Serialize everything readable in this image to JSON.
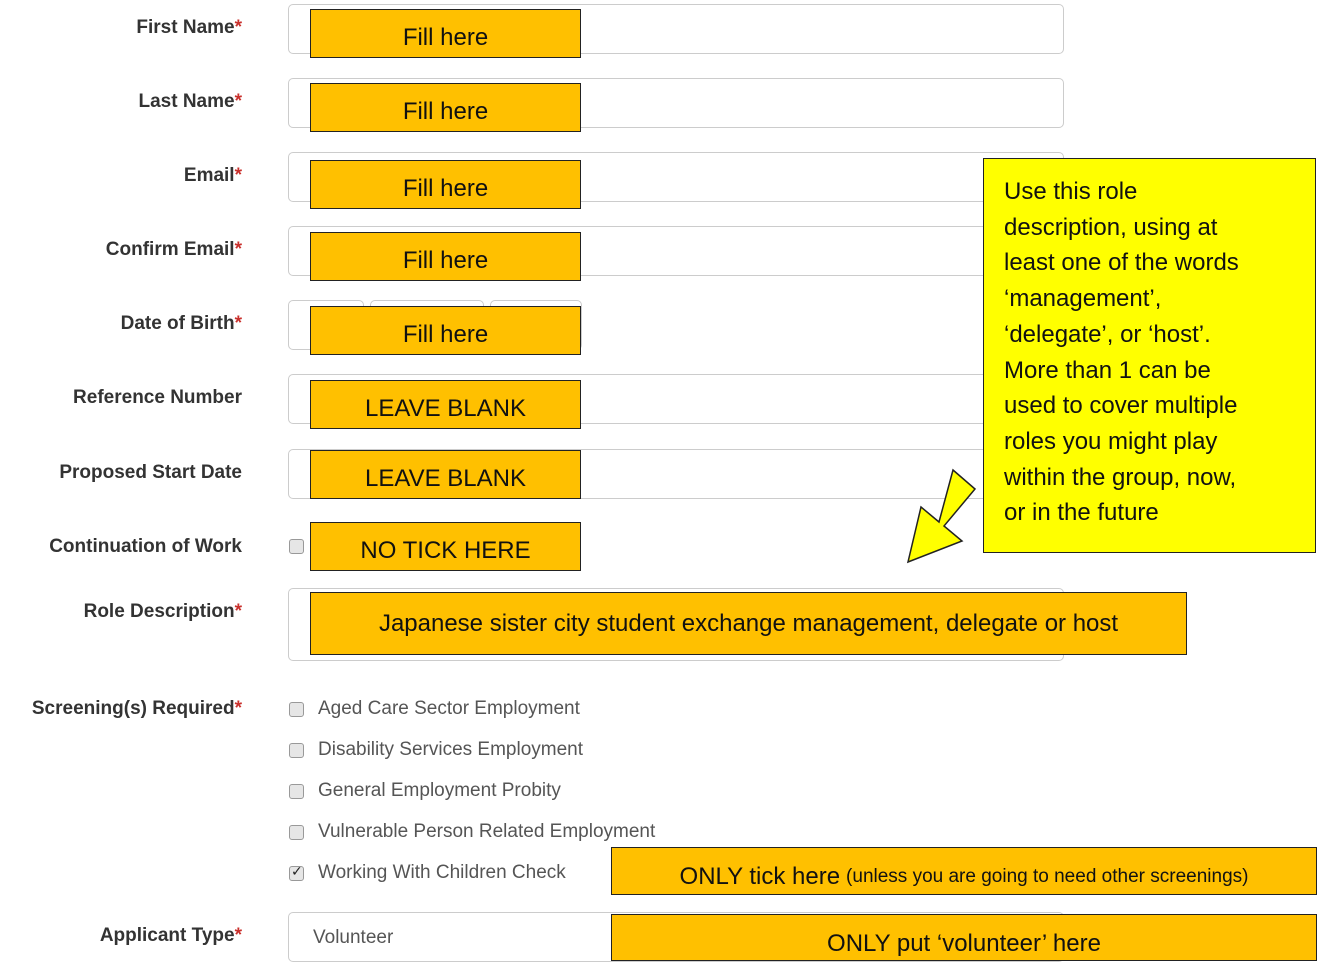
{
  "fields": {
    "first_name": "First Name",
    "last_name": "Last Name",
    "email": "Email",
    "confirm_email": "Confirm Email",
    "dob": "Date of Birth",
    "reference_number": "Reference Number",
    "proposed_start_date": "Proposed Start Date",
    "continuation_of_work": "Continuation of Work",
    "role_description": "Role Description",
    "screenings_required": "Screening(s) Required",
    "applicant_type": "Applicant Type",
    "required_mark": "*"
  },
  "screenings": [
    {
      "label": "Aged Care Sector Employment",
      "checked": false
    },
    {
      "label": "Disability Services Employment",
      "checked": false
    },
    {
      "label": "General Employment Probity",
      "checked": false
    },
    {
      "label": "Vulnerable Person Related Employment",
      "checked": false
    },
    {
      "label": "Working With Children Check",
      "checked": true
    }
  ],
  "applicant_type_value": "Volunteer",
  "continuation_checked": false,
  "annotations": {
    "fill_here": "Fill here",
    "leave_blank": "LEAVE BLANK",
    "no_tick": "NO TICK HERE",
    "role_text": "Japanese sister city student exchange management, delegate or host",
    "only_tick_main": "ONLY  tick  here",
    "only_tick_note": "(unless you are going to need other screenings)",
    "only_volunteer": "ONLY put  ‘volunteer’  here",
    "callout_lines": [
      "Use this role",
      "description, using at",
      "least one of the words",
      "‘management’,",
      "‘delegate’, or ‘host’.",
      "More than 1 can be",
      "used to cover multiple",
      "roles you might play",
      "within the group, now,",
      "or in the future"
    ]
  },
  "colors": {
    "note_orange": "#ffc000",
    "callout_yellow": "#ffff00",
    "required_red": "#c9302c"
  }
}
